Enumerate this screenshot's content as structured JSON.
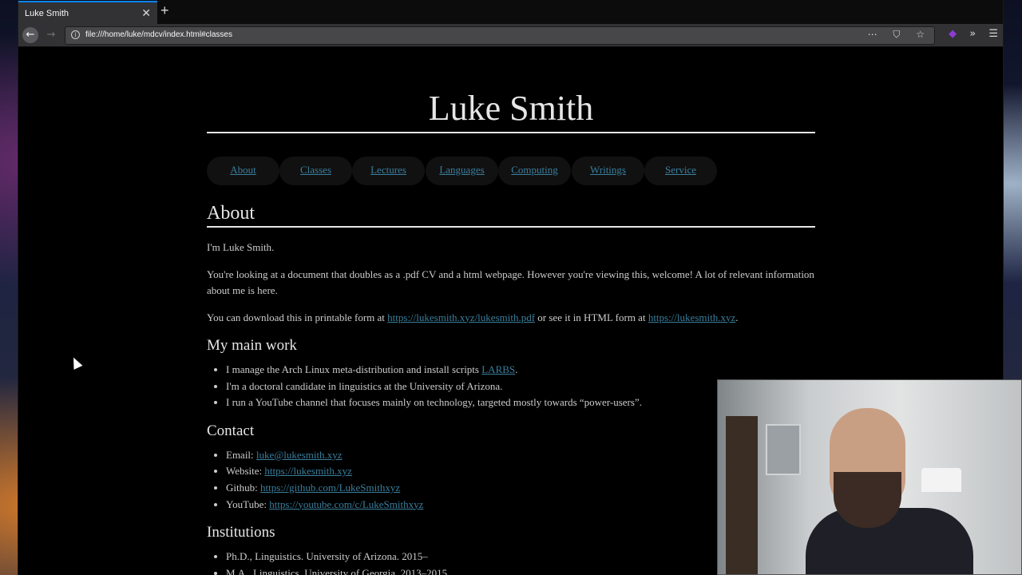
{
  "browser": {
    "tab_title": "Luke Smith",
    "tab_close": "✕",
    "new_tab": "+",
    "back_glyph": "←",
    "forward_glyph": "→",
    "url": "file:///home/luke/mdcv/index.html#classes",
    "info_glyph": "i",
    "url_actions": "⋯ ⛉ ☆",
    "toolbar_extension": "◆",
    "toolbar_overflow": "»",
    "toolbar_menu": "☰",
    "accent_color": "#0a84ff"
  },
  "page": {
    "title": "Luke Smith",
    "nav": [
      "About",
      "Classes",
      "Lectures",
      "Languages",
      "Computing",
      "Writings",
      "Service"
    ],
    "about": {
      "heading": "About",
      "p1": "I'm Luke Smith.",
      "p2": "You're looking at a document that doubles as a .pdf CV and a html webpage. However you're viewing this, welcome! A lot of relevant information about me is here.",
      "p3_prefix": "You can download this in printable form at ",
      "p3_link1": "https://lukesmith.xyz/lukesmith.pdf",
      "p3_mid": " or see it in HTML form at ",
      "p3_link2": "https://lukesmith.xyz",
      "p3_suffix": "."
    },
    "main_work": {
      "heading": "My main work",
      "item1_prefix": "I manage the Arch Linux meta-distribution and install scripts ",
      "item1_link": "LARBS",
      "item1_suffix": ".",
      "item2": "I'm a doctoral candidate in linguistics at the University of Arizona.",
      "item3": "I run a YouTube channel that focuses mainly on technology, targeted mostly towards “power-users”."
    },
    "contact": {
      "heading": "Contact",
      "email_label": "Email: ",
      "email": "luke@lukesmith.xyz",
      "website_label": "Website: ",
      "website": "https://lukesmith.xyz",
      "github_label": "Github: ",
      "github": "https://github.com/LukeSmithxyz",
      "youtube_label": "YouTube: ",
      "youtube": "https://youtube.com/c/LukeSmithxyz"
    },
    "institutions": {
      "heading": "Institutions",
      "item1": "Ph.D., Linguistics. University of Arizona. 2015–",
      "item2": "M.A., Linguistics. University of Georgia. 2013–2015"
    },
    "link_color": "#3a7f9d",
    "text_color": "#cccccc"
  }
}
